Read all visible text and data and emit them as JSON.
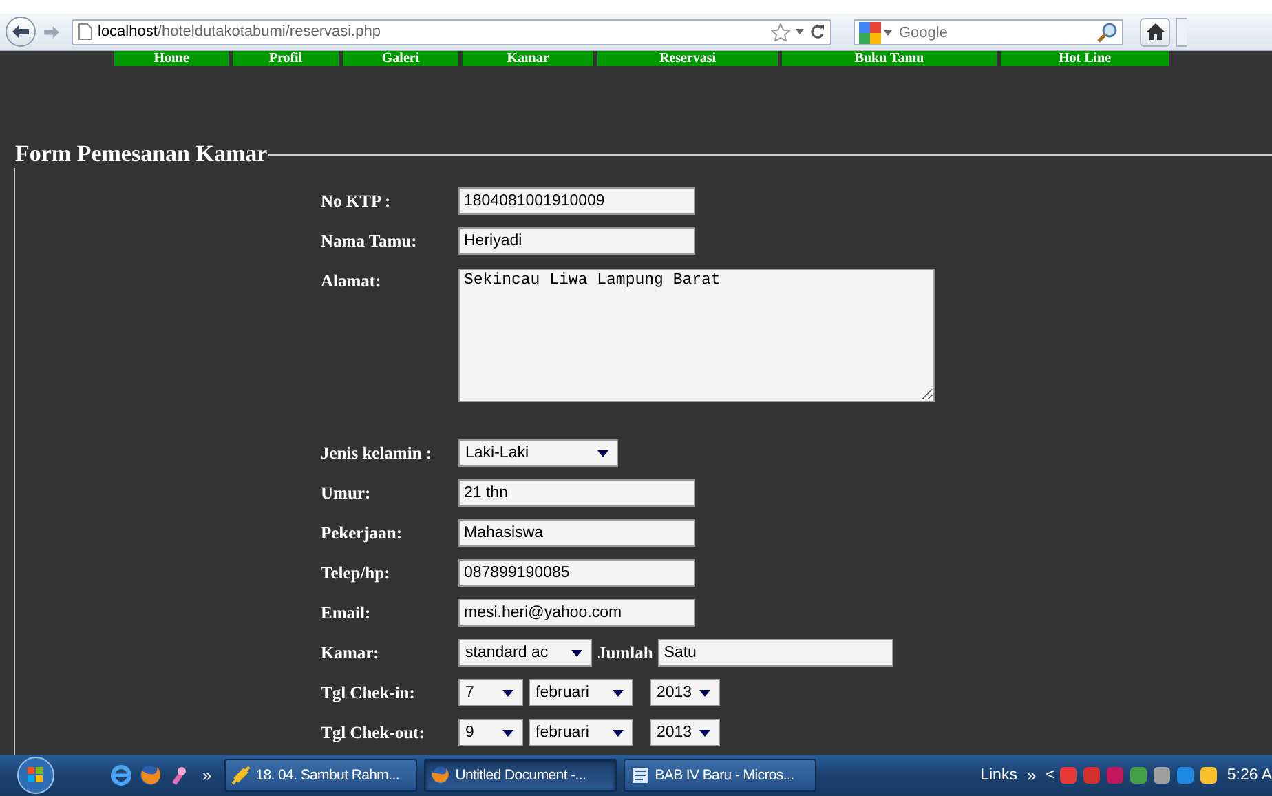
{
  "browser": {
    "url_host": "localhost",
    "url_path": "/hoteldutakotabumi/reservasi.php",
    "search_placeholder": "Google"
  },
  "nav": {
    "items": [
      {
        "label": "Home"
      },
      {
        "label": "Profil"
      },
      {
        "label": "Galeri"
      },
      {
        "label": "Kamar"
      },
      {
        "label": "Reservasi"
      },
      {
        "label": "Buku Tamu"
      },
      {
        "label": "Hot Line"
      }
    ]
  },
  "form": {
    "legend": "Form Pemesanan Kamar",
    "fields": [
      {
        "kind": "text",
        "label": "No KTP :",
        "value": "1804081001910009"
      },
      {
        "kind": "text",
        "label": "Nama Tamu:",
        "value": "Heriyadi"
      },
      {
        "kind": "textarea",
        "label": "Alamat:",
        "value": "Sekincau Liwa Lampung Barat"
      },
      {
        "kind": "select",
        "label": "Jenis kelamin :",
        "value": "Laki-Laki"
      },
      {
        "kind": "text",
        "label": "Umur:",
        "value": "21 thn"
      },
      {
        "kind": "text",
        "label": "Pekerjaan:",
        "value": "Mahasiswa"
      },
      {
        "kind": "text",
        "label": "Telep/hp:",
        "value": "087899190085"
      },
      {
        "kind": "text",
        "label": "Email:",
        "value": "mesi.heri@yahoo.com"
      },
      {
        "kind": "room",
        "label": "Kamar:",
        "value": "standard ac",
        "qty_label": "Jumlah",
        "qty": "Satu"
      },
      {
        "kind": "date",
        "label": "Tgl Chek-in:",
        "day": "7",
        "month": "februari",
        "year": "2013"
      },
      {
        "kind": "date",
        "label": "Tgl Chek-out:",
        "day": "9",
        "month": "februari",
        "year": "2013"
      }
    ]
  },
  "taskbar": {
    "more": "»",
    "tasks": [
      {
        "label": "18. 04. Sambut Rahm...",
        "selected": false
      },
      {
        "label": "Untitled Document -...",
        "selected": true
      },
      {
        "label": "BAB IV Baru - Micros...",
        "selected": false
      }
    ],
    "links": "Links",
    "links_more": "»",
    "tray_toggle": "<",
    "clock": "5:26 A"
  }
}
